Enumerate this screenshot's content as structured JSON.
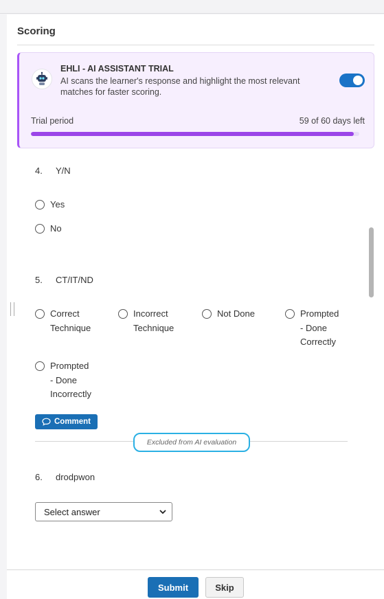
{
  "section": {
    "title": "Scoring"
  },
  "ai_trial": {
    "icon": "robot-icon",
    "title": "EHLI - AI ASSISTANT TRIAL",
    "description": "AI scans the learner's response and highlight the most relevant matches for faster scoring.",
    "toggle_on": true,
    "trial_label": "Trial period",
    "days_left": "59 of 60 days left",
    "progress_fraction": 0.983,
    "accent_color": "#9b45e8"
  },
  "questions": [
    {
      "number": "4.",
      "text": "Y/N",
      "options": [
        "Yes",
        "No"
      ]
    },
    {
      "number": "5.",
      "text": "CT/IT/ND",
      "options": [
        [
          "Correct",
          "Technique"
        ],
        [
          "Incorrect",
          "Technique"
        ],
        [
          "Not Done"
        ],
        [
          "Prompted",
          "- Done",
          "Correctly"
        ],
        [
          "Prompted",
          "- Done",
          "Incorrectly"
        ]
      ],
      "comment_label": "Comment",
      "excluded_label": "Excluded from AI evaluation"
    },
    {
      "number": "6.",
      "text": "drodpwon",
      "select_value": "Select answer"
    }
  ],
  "footer": {
    "submit_label": "Submit",
    "skip_label": "Skip"
  },
  "colors": {
    "primary": "#1a6fb5",
    "highlight_border": "#2bb0e4"
  }
}
